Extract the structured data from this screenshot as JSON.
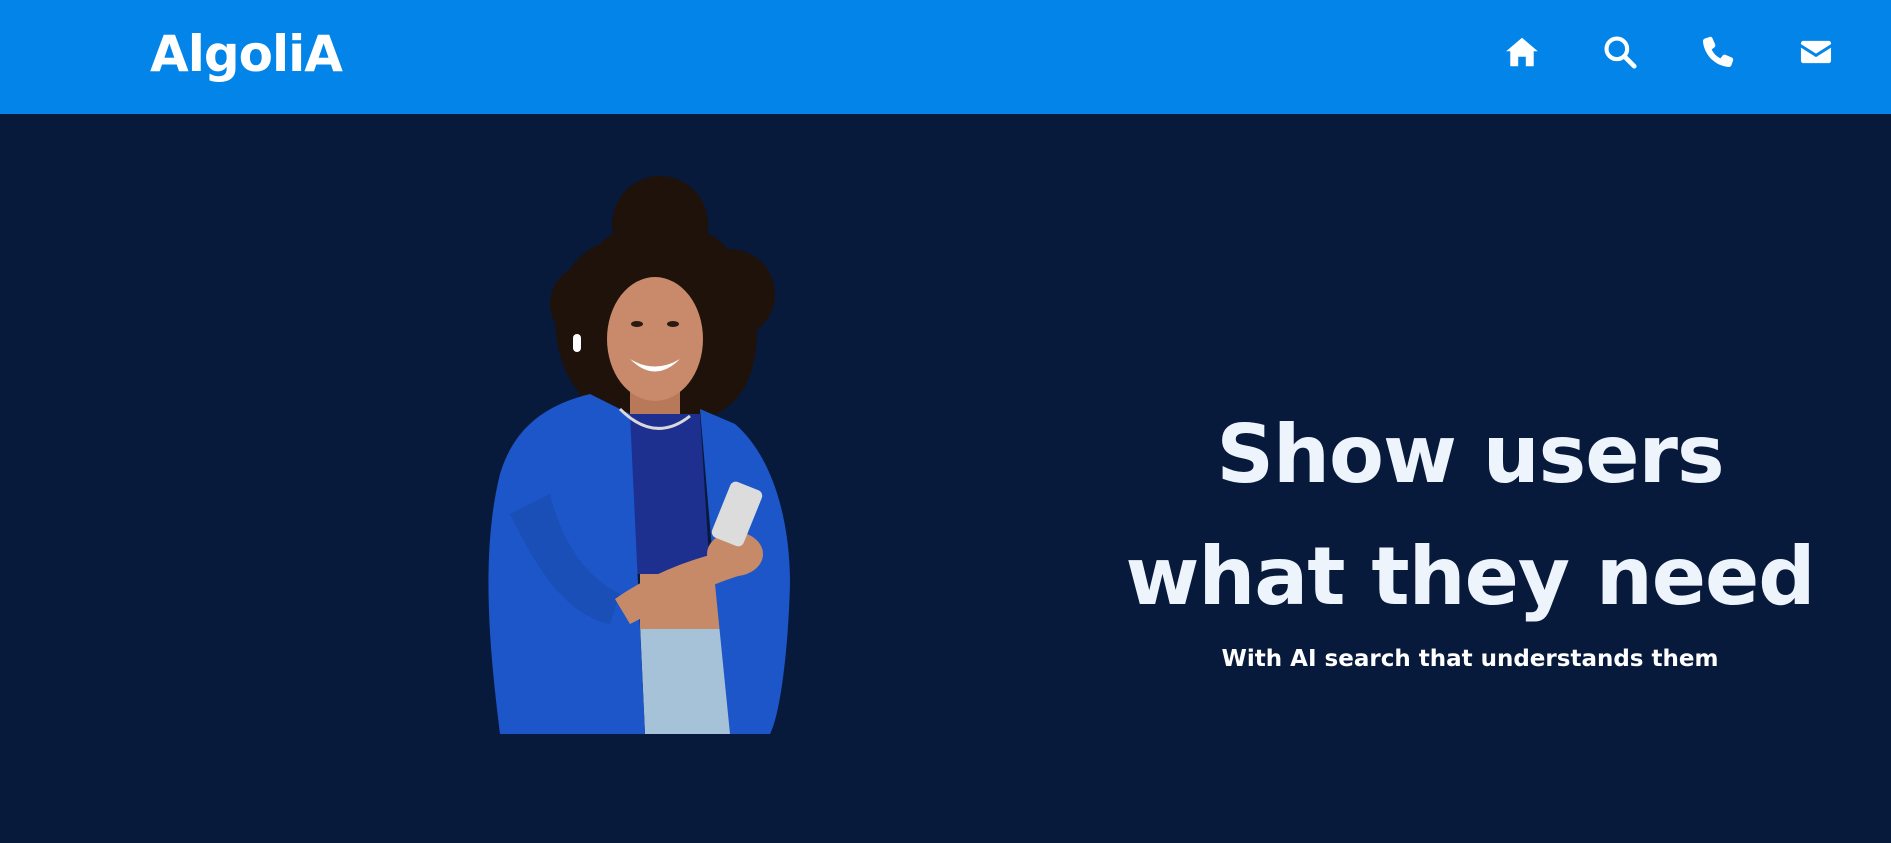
{
  "header": {
    "logo": "AlgoliA",
    "icons": [
      "home-icon",
      "search-icon",
      "phone-icon",
      "mail-icon"
    ]
  },
  "hero": {
    "headline_line1": "Show users",
    "headline_line2": "what they need",
    "subheadline": "With AI search that understands them",
    "image_subject": "smiling woman in blue jacket holding a phone"
  },
  "colors": {
    "navbar": "#0284e8",
    "background": "#081a3b",
    "text": "#eef4fc"
  }
}
